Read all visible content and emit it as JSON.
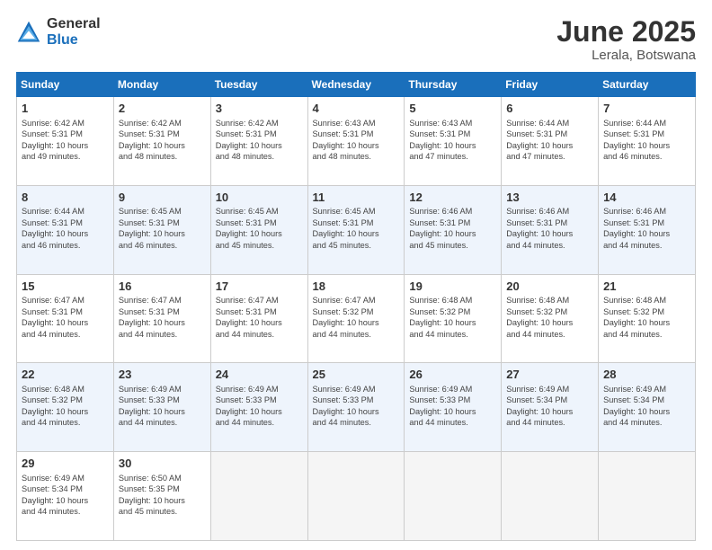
{
  "logo": {
    "general": "General",
    "blue": "Blue"
  },
  "title": {
    "month": "June 2025",
    "location": "Lerala, Botswana"
  },
  "headers": [
    "Sunday",
    "Monday",
    "Tuesday",
    "Wednesday",
    "Thursday",
    "Friday",
    "Saturday"
  ],
  "weeks": [
    [
      {
        "num": "1",
        "info": "Sunrise: 6:42 AM\nSunset: 5:31 PM\nDaylight: 10 hours\nand 49 minutes."
      },
      {
        "num": "2",
        "info": "Sunrise: 6:42 AM\nSunset: 5:31 PM\nDaylight: 10 hours\nand 48 minutes."
      },
      {
        "num": "3",
        "info": "Sunrise: 6:42 AM\nSunset: 5:31 PM\nDaylight: 10 hours\nand 48 minutes."
      },
      {
        "num": "4",
        "info": "Sunrise: 6:43 AM\nSunset: 5:31 PM\nDaylight: 10 hours\nand 48 minutes."
      },
      {
        "num": "5",
        "info": "Sunrise: 6:43 AM\nSunset: 5:31 PM\nDaylight: 10 hours\nand 47 minutes."
      },
      {
        "num": "6",
        "info": "Sunrise: 6:44 AM\nSunset: 5:31 PM\nDaylight: 10 hours\nand 47 minutes."
      },
      {
        "num": "7",
        "info": "Sunrise: 6:44 AM\nSunset: 5:31 PM\nDaylight: 10 hours\nand 46 minutes."
      }
    ],
    [
      {
        "num": "8",
        "info": "Sunrise: 6:44 AM\nSunset: 5:31 PM\nDaylight: 10 hours\nand 46 minutes."
      },
      {
        "num": "9",
        "info": "Sunrise: 6:45 AM\nSunset: 5:31 PM\nDaylight: 10 hours\nand 46 minutes."
      },
      {
        "num": "10",
        "info": "Sunrise: 6:45 AM\nSunset: 5:31 PM\nDaylight: 10 hours\nand 45 minutes."
      },
      {
        "num": "11",
        "info": "Sunrise: 6:45 AM\nSunset: 5:31 PM\nDaylight: 10 hours\nand 45 minutes."
      },
      {
        "num": "12",
        "info": "Sunrise: 6:46 AM\nSunset: 5:31 PM\nDaylight: 10 hours\nand 45 minutes."
      },
      {
        "num": "13",
        "info": "Sunrise: 6:46 AM\nSunset: 5:31 PM\nDaylight: 10 hours\nand 44 minutes."
      },
      {
        "num": "14",
        "info": "Sunrise: 6:46 AM\nSunset: 5:31 PM\nDaylight: 10 hours\nand 44 minutes."
      }
    ],
    [
      {
        "num": "15",
        "info": "Sunrise: 6:47 AM\nSunset: 5:31 PM\nDaylight: 10 hours\nand 44 minutes."
      },
      {
        "num": "16",
        "info": "Sunrise: 6:47 AM\nSunset: 5:31 PM\nDaylight: 10 hours\nand 44 minutes."
      },
      {
        "num": "17",
        "info": "Sunrise: 6:47 AM\nSunset: 5:31 PM\nDaylight: 10 hours\nand 44 minutes."
      },
      {
        "num": "18",
        "info": "Sunrise: 6:47 AM\nSunset: 5:32 PM\nDaylight: 10 hours\nand 44 minutes."
      },
      {
        "num": "19",
        "info": "Sunrise: 6:48 AM\nSunset: 5:32 PM\nDaylight: 10 hours\nand 44 minutes."
      },
      {
        "num": "20",
        "info": "Sunrise: 6:48 AM\nSunset: 5:32 PM\nDaylight: 10 hours\nand 44 minutes."
      },
      {
        "num": "21",
        "info": "Sunrise: 6:48 AM\nSunset: 5:32 PM\nDaylight: 10 hours\nand 44 minutes."
      }
    ],
    [
      {
        "num": "22",
        "info": "Sunrise: 6:48 AM\nSunset: 5:32 PM\nDaylight: 10 hours\nand 44 minutes."
      },
      {
        "num": "23",
        "info": "Sunrise: 6:49 AM\nSunset: 5:33 PM\nDaylight: 10 hours\nand 44 minutes."
      },
      {
        "num": "24",
        "info": "Sunrise: 6:49 AM\nSunset: 5:33 PM\nDaylight: 10 hours\nand 44 minutes."
      },
      {
        "num": "25",
        "info": "Sunrise: 6:49 AM\nSunset: 5:33 PM\nDaylight: 10 hours\nand 44 minutes."
      },
      {
        "num": "26",
        "info": "Sunrise: 6:49 AM\nSunset: 5:33 PM\nDaylight: 10 hours\nand 44 minutes."
      },
      {
        "num": "27",
        "info": "Sunrise: 6:49 AM\nSunset: 5:34 PM\nDaylight: 10 hours\nand 44 minutes."
      },
      {
        "num": "28",
        "info": "Sunrise: 6:49 AM\nSunset: 5:34 PM\nDaylight: 10 hours\nand 44 minutes."
      }
    ],
    [
      {
        "num": "29",
        "info": "Sunrise: 6:49 AM\nSunset: 5:34 PM\nDaylight: 10 hours\nand 44 minutes."
      },
      {
        "num": "30",
        "info": "Sunrise: 6:50 AM\nSunset: 5:35 PM\nDaylight: 10 hours\nand 45 minutes."
      },
      {
        "num": "",
        "info": ""
      },
      {
        "num": "",
        "info": ""
      },
      {
        "num": "",
        "info": ""
      },
      {
        "num": "",
        "info": ""
      },
      {
        "num": "",
        "info": ""
      }
    ]
  ]
}
